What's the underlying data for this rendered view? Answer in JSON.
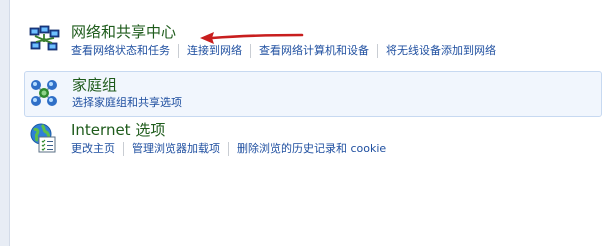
{
  "categories": {
    "network": {
      "title": "网络和共享中心",
      "links": [
        "查看网络状态和任务",
        "连接到网络",
        "查看网络计算机和设备",
        "将无线设备添加到网络"
      ]
    },
    "homegroup": {
      "title": "家庭组",
      "links": [
        "选择家庭组和共享选项"
      ]
    },
    "internet": {
      "title": "Internet 选项",
      "links": [
        "更改主页",
        "管理浏览器加载项",
        "删除浏览的历史记录和 cookie"
      ]
    }
  },
  "colors": {
    "title": "#1e5b1b",
    "link": "#1f4fa0",
    "arrow": "#c81e1e",
    "selected_bg": "#f1f6fd"
  },
  "icons": {
    "network": "network-computers-icon",
    "homegroup": "homegroup-icon",
    "internet": "internet-globe-icon",
    "annotation": "red-arrow-icon"
  }
}
